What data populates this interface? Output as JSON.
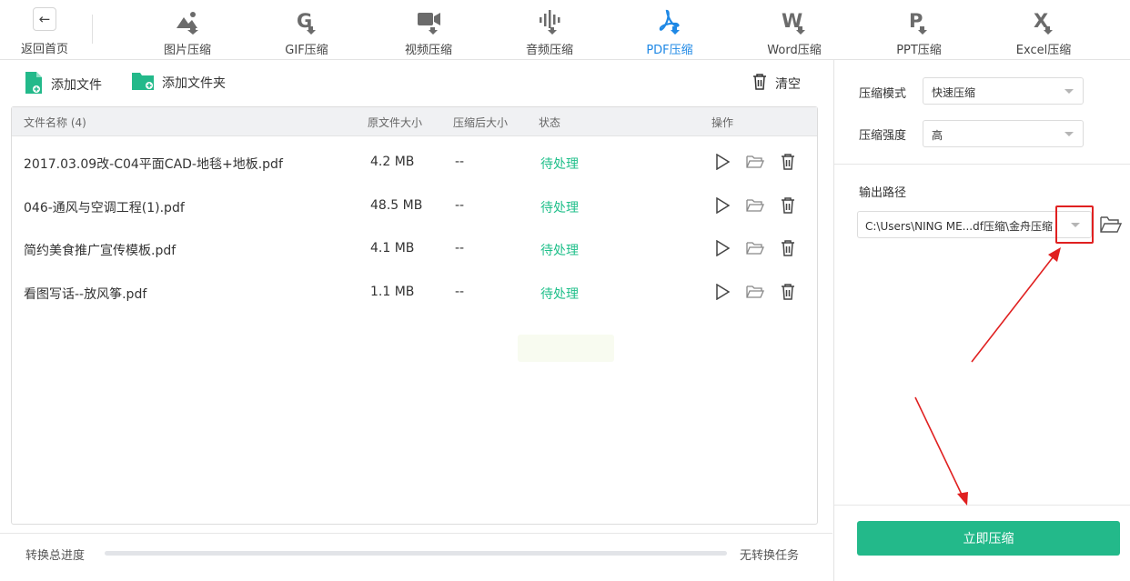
{
  "nav": {
    "back_arrow": "←",
    "back_label": "返回首页",
    "items": [
      {
        "label": "图片压缩",
        "icon": "image-compress-icon"
      },
      {
        "label": "GIF压缩",
        "icon": "gif-compress-icon"
      },
      {
        "label": "视频压缩",
        "icon": "video-compress-icon"
      },
      {
        "label": "音频压缩",
        "icon": "audio-compress-icon"
      },
      {
        "label": "PDF压缩",
        "icon": "pdf-compress-icon"
      },
      {
        "label": "Word压缩",
        "icon": "word-compress-icon"
      },
      {
        "label": "PPT压缩",
        "icon": "ppt-compress-icon"
      },
      {
        "label": "Excel压缩",
        "icon": "excel-compress-icon"
      }
    ],
    "active_index": 4
  },
  "toolbar": {
    "add_file": "添加文件",
    "add_folder": "添加文件夹",
    "clear": "清空"
  },
  "table": {
    "headers": {
      "name": "文件名称 (4)",
      "original_size": "原文件大小",
      "compressed_size": "压缩后大小",
      "status": "状态",
      "actions": "操作"
    },
    "rows": [
      {
        "name": "2017.03.09改-C04平面CAD-地毯+地板.pdf",
        "size": "4.2 MB",
        "compressed": "--",
        "status": "待处理"
      },
      {
        "name": "046-通风与空调工程(1).pdf",
        "size": "48.5 MB",
        "compressed": "--",
        "status": "待处理"
      },
      {
        "name": "简约美食推广宣传模板.pdf",
        "size": "4.1 MB",
        "compressed": "--",
        "status": "待处理"
      },
      {
        "name": "看图写话--放风筝.pdf",
        "size": "1.1 MB",
        "compressed": "--",
        "status": "待处理"
      }
    ]
  },
  "progress": {
    "label": "转换总进度",
    "value": 0,
    "message": "无转换任务"
  },
  "settings": {
    "mode_label": "压缩模式",
    "mode_value": "快速压缩",
    "strength_label": "压缩强度",
    "strength_value": "高",
    "output_label": "输出路径",
    "output_value": "C:\\Users\\NING ME...df压缩\\金舟压缩",
    "compress_button": "立即压缩"
  },
  "colors": {
    "accent_green": "#23b98a",
    "status_green": "#1fbf8a",
    "active_blue": "#1e88e5",
    "annotation_red": "#e02020"
  }
}
